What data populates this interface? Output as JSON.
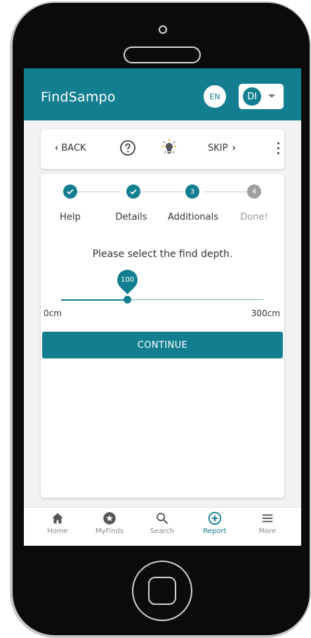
{
  "app": {
    "title": "FindSampo",
    "language": "EN",
    "user_initials": "DI",
    "accent_color": "#127e90"
  },
  "toolbar": {
    "back_label": "BACK",
    "back_icon": "chevron-left-icon",
    "help_icon": "help-circle-icon",
    "tip_icon": "lightbulb-icon",
    "skip_label": "SKIP",
    "skip_icon": "chevron-right-icon",
    "more_icon": "more-vert-icon"
  },
  "stepper": {
    "steps": [
      {
        "label": "Help",
        "state": "done"
      },
      {
        "label": "Details",
        "state": "done"
      },
      {
        "label": "Additionals",
        "state": "active",
        "number": "3"
      },
      {
        "label": "Done!",
        "state": "todo",
        "number": "4"
      }
    ]
  },
  "question": {
    "text": "Please select the find depth."
  },
  "slider": {
    "value": "100",
    "min_label": "0cm",
    "max_label": "300cm",
    "min": 0,
    "max": 300
  },
  "continue_label": "CONTINUE",
  "bottom_nav": {
    "items": [
      {
        "label": "Home",
        "icon": "home-icon",
        "active": false
      },
      {
        "label": "MyFinds",
        "icon": "star-badge-icon",
        "active": false
      },
      {
        "label": "Search",
        "icon": "search-icon",
        "active": false
      },
      {
        "label": "Report",
        "icon": "add-circle-icon",
        "active": true
      },
      {
        "label": "More",
        "icon": "menu-icon",
        "active": false
      }
    ]
  }
}
